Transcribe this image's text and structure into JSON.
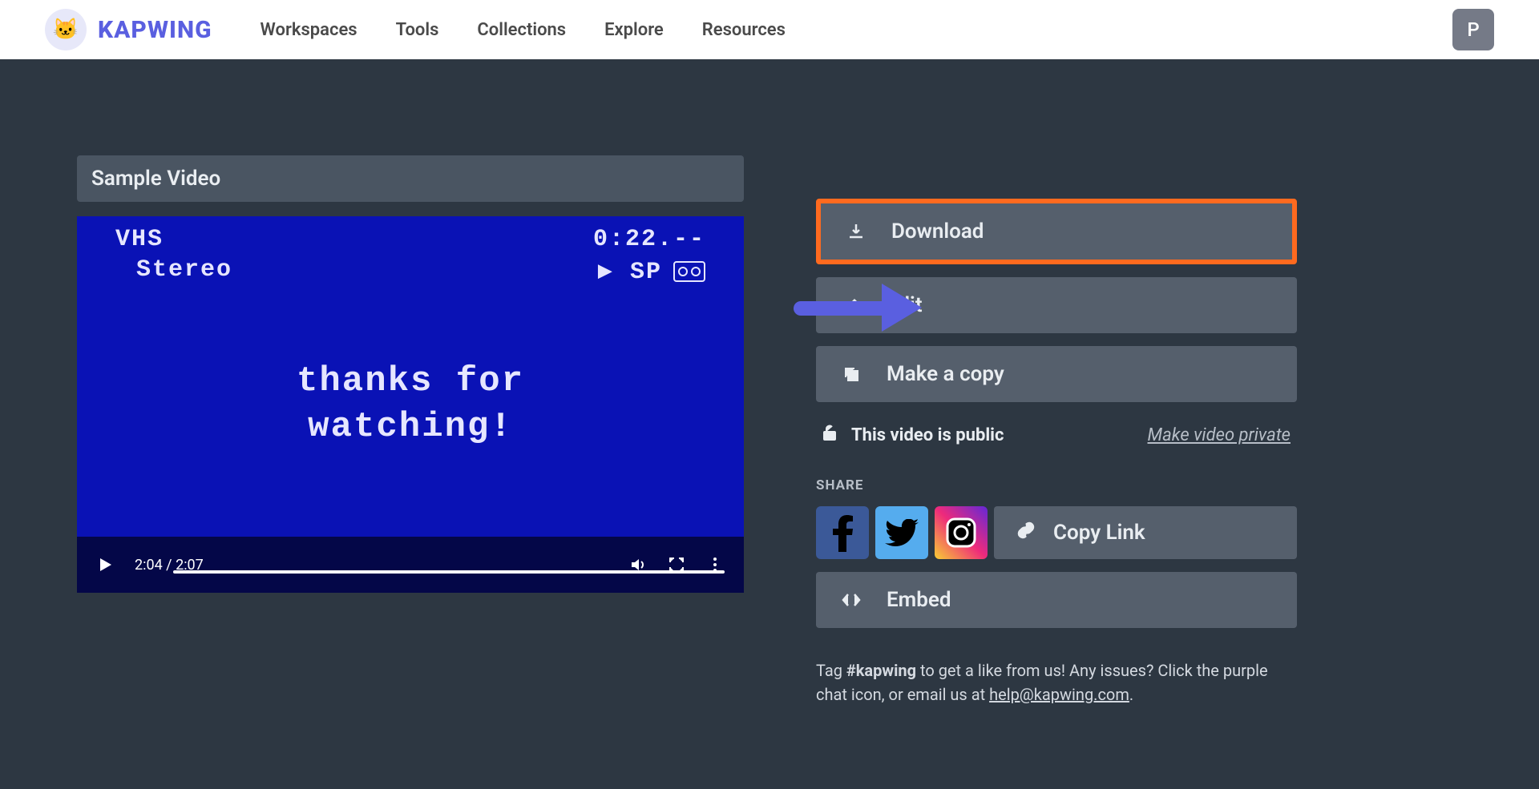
{
  "header": {
    "brand": "KAPWING",
    "nav": [
      "Workspaces",
      "Tools",
      "Collections",
      "Explore",
      "Resources"
    ],
    "avatar_initial": "P"
  },
  "video": {
    "title": "Sample Video",
    "overlay": {
      "topleft1": "VHS",
      "topleft2": "Stereo",
      "topright1": "0:22.--",
      "topright2": "▶  SP",
      "center": "thanks for\nwatching!"
    },
    "player": {
      "current": "2:04",
      "duration": "2:07"
    }
  },
  "actions": {
    "download": "Download",
    "edit": "Edit",
    "copy": "Make a copy"
  },
  "privacy": {
    "status": "This video is public",
    "toggle": "Make video private"
  },
  "share": {
    "label": "SHARE",
    "copy_link": "Copy Link",
    "embed": "Embed"
  },
  "footer": {
    "pre": "Tag ",
    "hashtag": "#kapwing",
    "mid": " to get a like from us! Any issues? Click the purple chat icon, or email us at ",
    "email": "help@kapwing.com",
    "post": "."
  }
}
